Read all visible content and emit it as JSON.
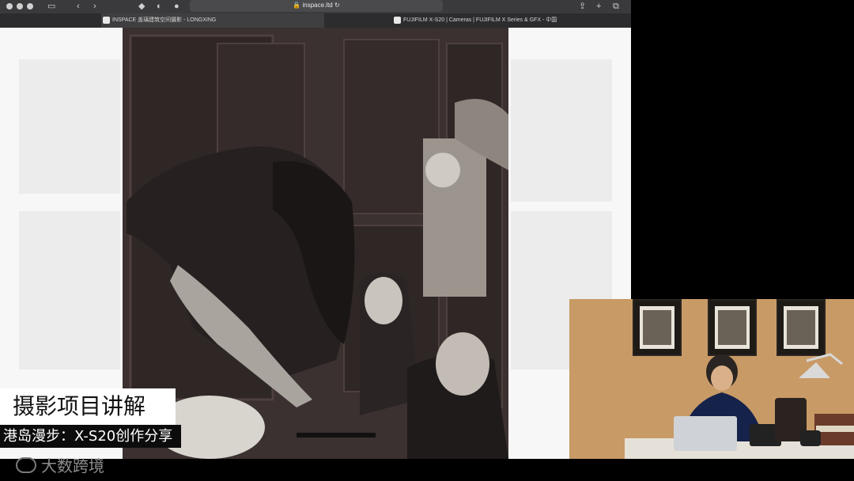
{
  "browser": {
    "url": "inspace.ltd",
    "tabs": [
      {
        "label": "INSPACE 盖璃建筑空间摄影 - LONGXING",
        "active": true
      },
      {
        "label": "FUJIFILM X-S20 | Cameras | FUJIFILM X Series & GFX - 中国",
        "active": false
      }
    ]
  },
  "overlay": {
    "title": "摄影项目讲解",
    "subtitle": "港岛漫步：X-S20创作分享"
  },
  "watermark": {
    "text": "大数跨境"
  },
  "icons": [
    "window-controls-icon",
    "sidebar-icon",
    "back-icon",
    "forward-icon",
    "shield-icon",
    "lock-icon",
    "reload-icon",
    "share-icon",
    "new-tab-icon",
    "tabs-overview-icon"
  ]
}
